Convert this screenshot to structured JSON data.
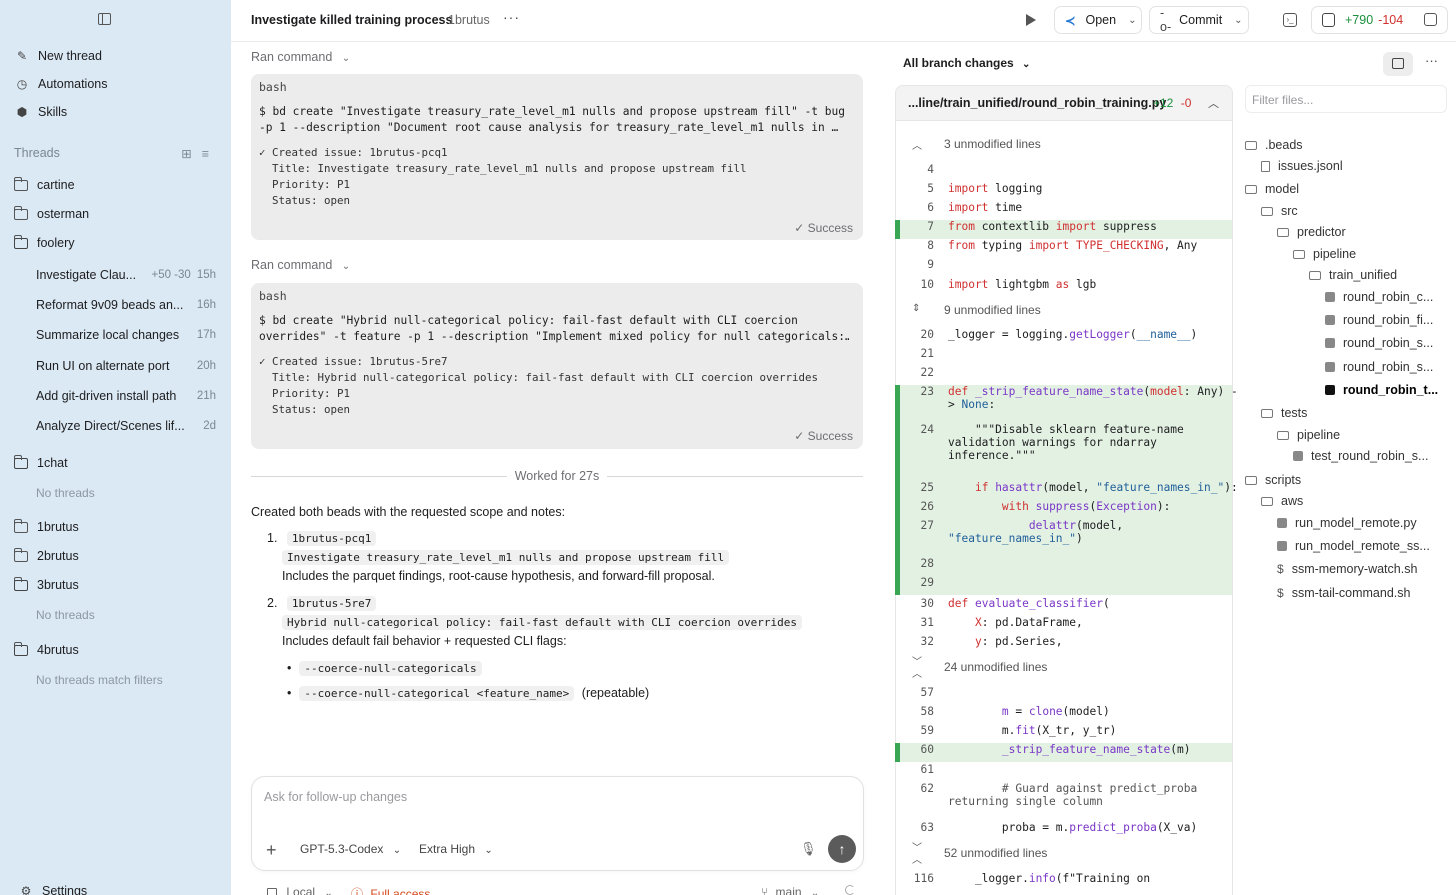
{
  "sidebar": {
    "nav": [
      {
        "label": "New thread",
        "icon": "compose-icon"
      },
      {
        "label": "Automations",
        "icon": "clock-icon"
      },
      {
        "label": "Skills",
        "icon": "cube-icon"
      }
    ],
    "threads_header": "Threads",
    "projects": [
      {
        "name": "cartine"
      },
      {
        "name": "osterman"
      },
      {
        "name": "foolery"
      }
    ],
    "foolery_threads": [
      {
        "title": "Investigate Clau...",
        "stat": "+50 -30",
        "age": "15h"
      },
      {
        "title": "Reformat 9v09 beads an...",
        "age": "16h"
      },
      {
        "title": "Summarize local changes",
        "age": "17h"
      },
      {
        "title": "Run UI on alternate port",
        "age": "20h"
      },
      {
        "title": "Add git-driven install path",
        "age": "21h"
      },
      {
        "title": "Analyze Direct/Scenes lif...",
        "age": "2d"
      }
    ],
    "project_1chat": "1chat",
    "no_threads": "No threads",
    "project_1brutus": "1brutus",
    "project_2brutus": "2brutus",
    "project_3brutus": "3brutus",
    "no_threads_2": "No threads",
    "project_4brutus": "4brutus",
    "no_match": "No threads match filters",
    "settings": "Settings"
  },
  "header": {
    "title": "Investigate killed training process",
    "project": "1brutus",
    "open_label": "Open",
    "commit_label": "Commit",
    "diff_add": "+790",
    "diff_del": "-104"
  },
  "chat": {
    "ran_command_1": "Ran command",
    "box1": {
      "lang": "bash",
      "cmd": "$ bd create \"Investigate treasury_rate_level_m1 nulls and propose upstream fill\" -t bug\n-p 1 --description \"Document root cause analysis for treasury_rate_level_m1 nulls in …",
      "out": "✓ Created issue: 1brutus-pcq1\n  Title: Investigate treasury_rate_level_m1 nulls and propose upstream fill\n  Priority: P1\n  Status: open",
      "status": "✓ Success"
    },
    "ran_command_2": "Ran command",
    "box2": {
      "lang": "bash",
      "cmd": "$ bd create \"Hybrid null-categorical policy: fail-fast default with CLI coercion\noverrides\" -t feature -p 1 --description \"Implement mixed policy for null categoricals:…",
      "out": "✓ Created issue: 1brutus-5re7\n  Title: Hybrid null-categorical policy: fail-fast default with CLI coercion overrides\n  Priority: P1\n  Status: open",
      "status": "✓ Success"
    },
    "worked": "Worked for 27s",
    "summary": "Created both beads with the requested scope and notes:",
    "item1_num": "1.",
    "item1_id": "1brutus-pcq1",
    "item1_title": "Investigate treasury_rate_level_m1 nulls and propose upstream fill",
    "item1_desc": "Includes the parquet findings, root-cause hypothesis, and forward-fill proposal.",
    "item2_num": "2.",
    "item2_id": "1brutus-5re7",
    "item2_title": "Hybrid null-categorical policy: fail-fast default with CLI coercion overrides",
    "item2_desc": "Includes default fail behavior + requested CLI flags:",
    "flag1": "--coerce-null-categoricals",
    "flag2": "--coerce-null-categorical <feature_name>",
    "flag2_note": "(repeatable)",
    "composer_placeholder": "Ask for follow-up changes",
    "model": "GPT-5.3-Codex",
    "effort": "Extra High",
    "env": "Local",
    "access": "Full access",
    "branch": "main"
  },
  "diff": {
    "branch_changes": "All branch changes",
    "file": "...line/train_unified/round_robin_training.py",
    "file_add": "+12",
    "file_del": "-0",
    "unmod_1": "3 unmodified lines",
    "unmod_2": "9 unmodified lines",
    "unmod_3": "24 unmodified lines",
    "unmod_4": "52 unmodified lines",
    "filter_placeholder": "Filter files..."
  },
  "tree": [
    {
      "label": ".beads",
      "kind": "folder"
    },
    {
      "label": "issues.jsonl",
      "kind": "file"
    },
    {
      "label": "model",
      "kind": "folder"
    },
    {
      "label": "src",
      "kind": "folder"
    },
    {
      "label": "predictor",
      "kind": "folder"
    },
    {
      "label": "pipeline",
      "kind": "folder"
    },
    {
      "label": "train_unified",
      "kind": "folder"
    },
    {
      "label": "round_robin_c...",
      "kind": "py"
    },
    {
      "label": "round_robin_fi...",
      "kind": "py"
    },
    {
      "label": "round_robin_s...",
      "kind": "py"
    },
    {
      "label": "round_robin_s...",
      "kind": "py"
    },
    {
      "label": "round_robin_t...",
      "kind": "py",
      "selected": true
    },
    {
      "label": "tests",
      "kind": "folder"
    },
    {
      "label": "pipeline",
      "kind": "folder"
    },
    {
      "label": "test_round_robin_s...",
      "kind": "py"
    },
    {
      "label": "scripts",
      "kind": "folder"
    },
    {
      "label": "aws",
      "kind": "folder"
    },
    {
      "label": "run_model_remote.py",
      "kind": "py"
    },
    {
      "label": "run_model_remote_ss...",
      "kind": "py"
    },
    {
      "label": "ssm-memory-watch.sh",
      "kind": "sh"
    },
    {
      "label": "ssm-tail-command.sh",
      "kind": "sh"
    }
  ]
}
